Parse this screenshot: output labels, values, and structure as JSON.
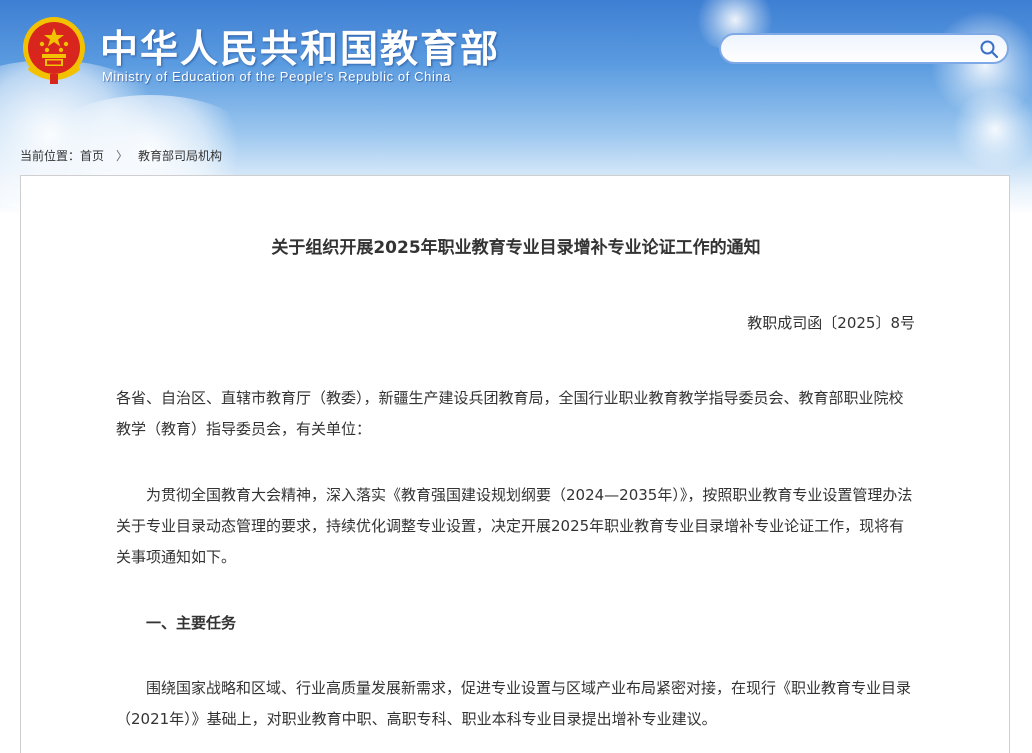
{
  "header": {
    "site_title_cn": "中华人民共和国教育部",
    "site_title_en": "Ministry of Education of the People's Republic of China",
    "search": {
      "value": "",
      "placeholder": ""
    },
    "colors": {
      "banner_top": "#3f7fd3",
      "banner_bottom": "#e8f2fb",
      "emblem_red": "#d8261f",
      "emblem_gold": "#f2c200"
    }
  },
  "breadcrumb": {
    "prefix": "当前位置：",
    "items": [
      "首页",
      "教育部司局机构"
    ],
    "separator": "〉"
  },
  "article": {
    "title": "关于组织开展2025年职业教育专业目录增补专业论证工作的通知",
    "doc_number": "教职成司函〔2025〕8号",
    "addressee": "各省、自治区、直辖市教育厅（教委），新疆生产建设兵团教育局，全国行业职业教育教学指导委员会、教育部职业院校教学（教育）指导委员会，有关单位：",
    "intro": "为贯彻全国教育大会精神，深入落实《教育强国建设规划纲要（2024—2035年）》，按照职业教育专业设置管理办法关于专业目录动态管理的要求，持续优化调整专业设置，决定开展2025年职业教育专业目录增补专业论证工作，现将有关事项通知如下。",
    "section1_heading": "一、主要任务",
    "section1_text": "围绕国家战略和区域、行业高质量发展新需求，促进专业设置与区域产业布局紧密对接，在现行《职业教育专业目录（2021年）》基础上，对职业教育中职、高职专科、职业本科专业目录提出增补专业建议。"
  },
  "icons": {
    "emblem": "national-emblem-icon",
    "search": "search-icon",
    "breadcrumb_separator": "chevron-right-icon"
  }
}
